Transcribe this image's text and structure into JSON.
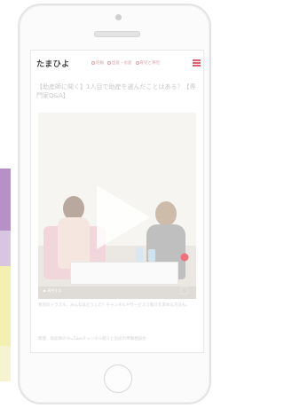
{
  "header": {
    "logo": "たまひよ",
    "nav": [
      "妊娠",
      "出産・お産",
      "育児と育児"
    ]
  },
  "article": {
    "title": "【助産師に聞く】1人目で助産を選んだことはある？【専門家Q&A】",
    "caption": "育児のトラブル、みんなはどうした？チャンネルやサービスで助けを求める方法も。",
    "footnote": "関連：助産師のYouTubeチャンネル紹介と出産の準備相談会"
  },
  "video": {
    "label": "▶ 再生する"
  },
  "colors": {
    "accent": "#e06070",
    "nav": "#d9a0a8"
  }
}
